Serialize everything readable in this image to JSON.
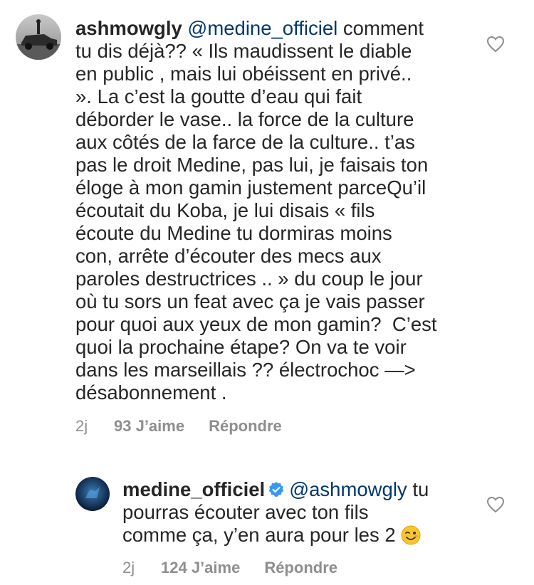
{
  "comments": [
    {
      "username": "ashmowgly",
      "mention": "@medine_officiel",
      "text": " comment\ntu dis déjà?? « Ils maudissent le diable\nen public , mais lui obéissent en privé..\n». La c’est la goutte d’eau qui fait\ndéborder le vase.. la force de la culture\naux côtés de la farce de la culture.. t’as\npas le droit Medine, pas lui, je faisais ton\néloge à mon gamin justement parceQu’il\nécoutait du Koba, je lui disais « fils\nécoute du Medine tu dormiras moins\ncon, arrête d’écouter des mecs aux\nparoles destructrices .. » du coup le jour\noù tu sors un feat avec ça je vais passer\npour quoi aux yeux de mon gamin?  C’est\nquoi la prochaine étape? On va te voir\ndans les marseillais ?? électrochoc —>\ndésabonnement .",
      "time": "2j",
      "likes": "93 J’aime",
      "reply": "Répondre",
      "avatar_icon": "car-silhouette-avatar"
    },
    {
      "username": "medine_officiel",
      "verified": true,
      "mention": "@ashmowgly",
      "text": " tu\npourras écouter avec ton fils\ncomme ça, y’en aura pour les 2 ",
      "emoji": "winking-face",
      "time": "2j",
      "likes": "124 J’aime",
      "reply": "Répondre",
      "avatar_icon": "blue-profile-avatar"
    }
  ],
  "colors": {
    "text": "#262626",
    "mention": "#00376b",
    "meta": "#8e8e8e",
    "verified": "#3897f0"
  }
}
